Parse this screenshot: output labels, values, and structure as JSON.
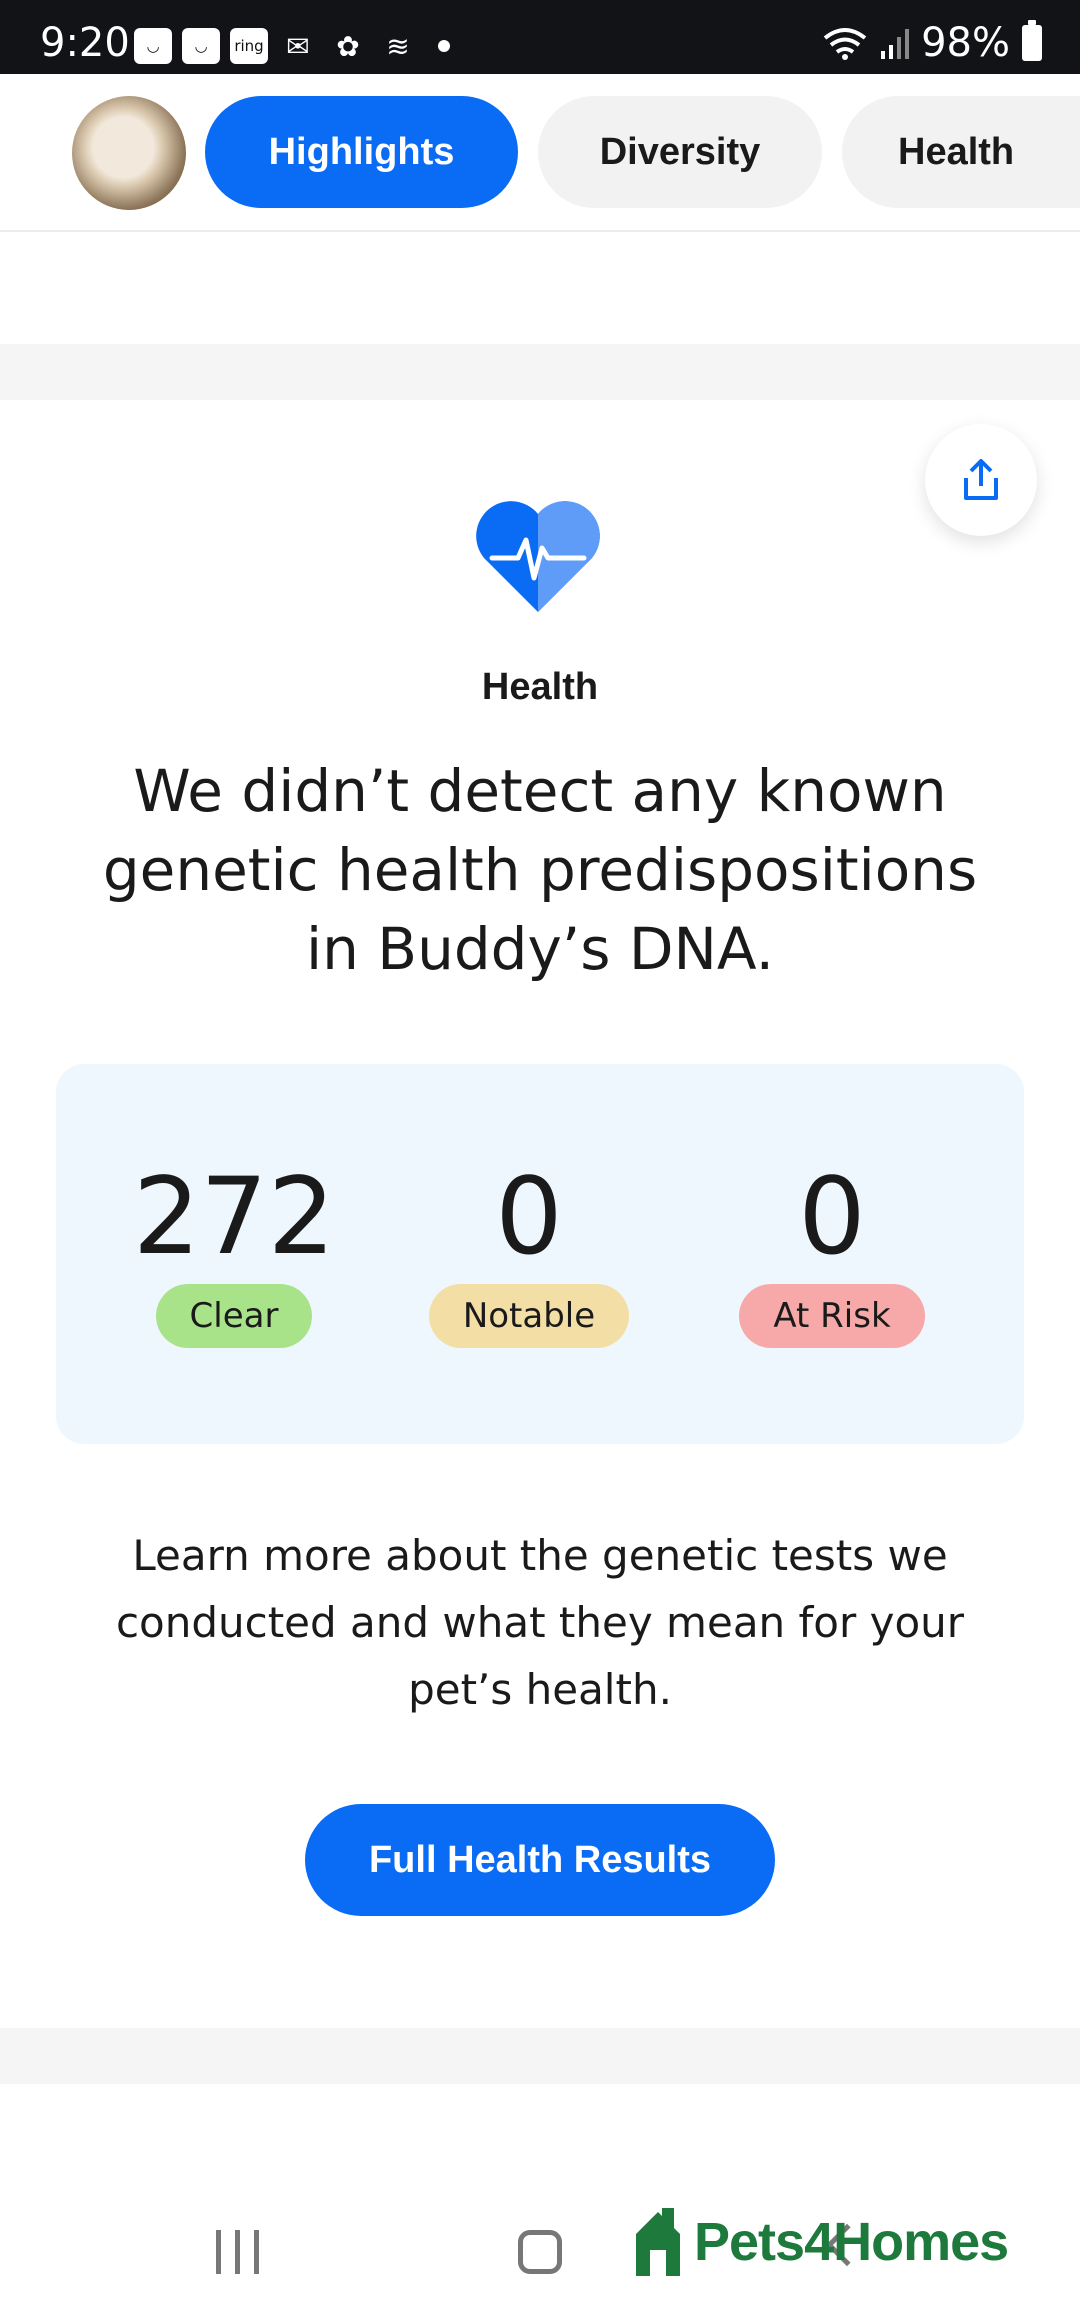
{
  "status_bar": {
    "time": "9:20",
    "notifications": [
      "amazon-icon",
      "amazon-icon",
      "ring-icon",
      "outlook-icon",
      "paw-icon",
      "stripes-icon"
    ],
    "ring_label": "ring",
    "battery": "98%"
  },
  "tabs": [
    {
      "label": "Highlights",
      "active": true
    },
    {
      "label": "Diversity",
      "active": false
    },
    {
      "label": "Health",
      "active": false
    }
  ],
  "health": {
    "section_label": "Health",
    "headline": "We didn’t detect any known genetic health predispositions in Buddy’s DNA.",
    "stats": [
      {
        "value": "272",
        "label": "Clear",
        "color": "#a8e38a"
      },
      {
        "value": "0",
        "label": "Notable",
        "color": "#f3dea5"
      },
      {
        "value": "0",
        "label": "At Risk",
        "color": "#f7a8a8"
      }
    ],
    "learn_more": "Learn more about the genetic tests we conducted and what they mean for your pet’s health.",
    "cta_label": "Full Health Results"
  },
  "colors": {
    "accent": "#0a6cf5",
    "panel": "#eff7fe",
    "watermark": "#1d7a3c"
  },
  "watermark": {
    "text": "Pets4Homes"
  }
}
